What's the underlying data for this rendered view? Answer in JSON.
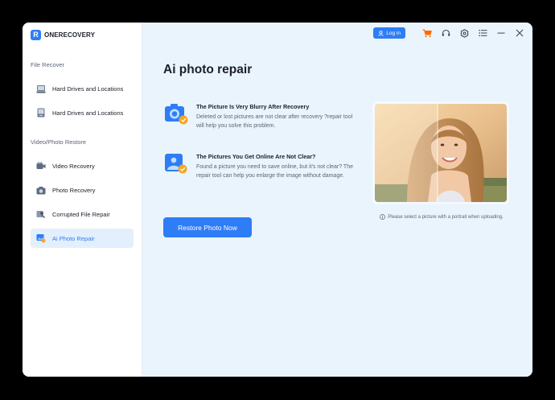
{
  "app": {
    "brand_letter": "R",
    "brand_name": "ONERECOVERY"
  },
  "sidebar": {
    "file_recover_title": "File Recover",
    "video_photo_title": "Video/Photo Restore",
    "items": [
      {
        "label": "Hard Drives and Locations",
        "icon": "hard-drive-icon"
      },
      {
        "label": "Hard Drives and Locations",
        "icon": "external-drive-icon"
      },
      {
        "label": "Video Recovery",
        "icon": "video-camera-icon"
      },
      {
        "label": "Photo Recovery",
        "icon": "camera-icon"
      },
      {
        "label": "Corrupted File Repair",
        "icon": "wrench-icon"
      },
      {
        "label": "Ai Photo Repair",
        "icon": "photo-repair-icon",
        "active": true
      }
    ]
  },
  "topbar": {
    "login_label": "Log in"
  },
  "main": {
    "title": "Ai photo repair",
    "features": [
      {
        "title": "The Picture Is Very Blurry After Recovery",
        "desc": "Deleted or lost pictures are not clear after recovery ?repair tool will help you solve this problem."
      },
      {
        "title": "The Pictures You Get Online Are Not Clear?",
        "desc": "Found a picture you need to save online, but it's not clear? The repair tool can help you enlarge the image without damage."
      }
    ],
    "restore_button": "Restore Photo Now",
    "upload_hint": "Please select a picture with a portrait when uploading."
  },
  "colors": {
    "accent": "#2f7df6",
    "main_bg": "#eaf4fc",
    "active_bg": "#e3effc",
    "cart": "#ff6a00"
  }
}
